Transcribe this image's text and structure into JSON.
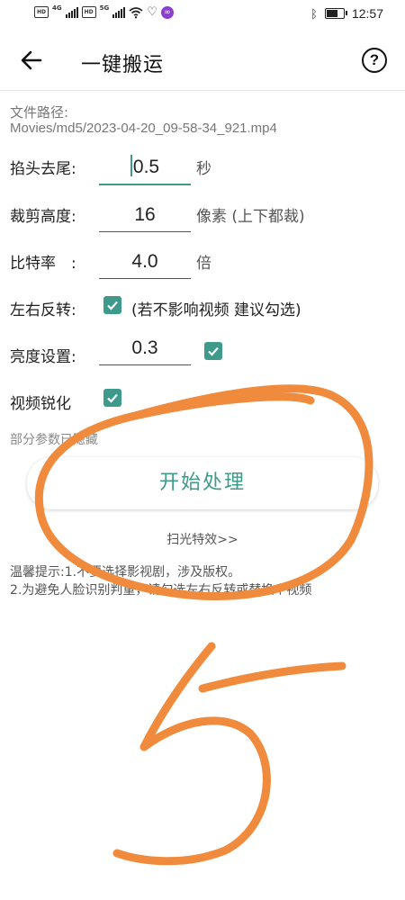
{
  "status_bar": {
    "hd1": "HD",
    "hd2": "HD",
    "net1": "4G",
    "net2": "5G",
    "time": "12:57",
    "battery_level": 0.6
  },
  "app_bar": {
    "title": "一键搬运"
  },
  "file": {
    "label": "文件路径:",
    "path": "Movies/md5/2023-04-20_09-58-34_921.mp4"
  },
  "settings": {
    "trim": {
      "label": "掐头去尾:",
      "value": "0.5",
      "unit": "秒"
    },
    "crop": {
      "label": "裁剪高度:",
      "value": "16",
      "unit": "像素 (上下都裁)"
    },
    "bitrate": {
      "label": "比特率　:",
      "value": "4.0",
      "unit": "倍"
    },
    "flip": {
      "label": "左右反转:",
      "checked": true,
      "text": "(若不影响视频 建议勾选)"
    },
    "brightness": {
      "label": "亮度设置:",
      "value": "0.3",
      "checked": true
    },
    "sharpen": {
      "label": "视频锐化",
      "checked": true
    }
  },
  "hidden_note": "部分参数已隐藏",
  "start_button": "开始处理",
  "scan_link": "扫光特效>>",
  "tips": {
    "line1": "温馨提示:1.不要选择影视剧，涉及版权。",
    "line2": "2.为避免人脸识别判重，请勾选左右反转或替换个视频"
  },
  "colors": {
    "accent": "#3e9a8a",
    "annotation": "#f08a3c"
  }
}
